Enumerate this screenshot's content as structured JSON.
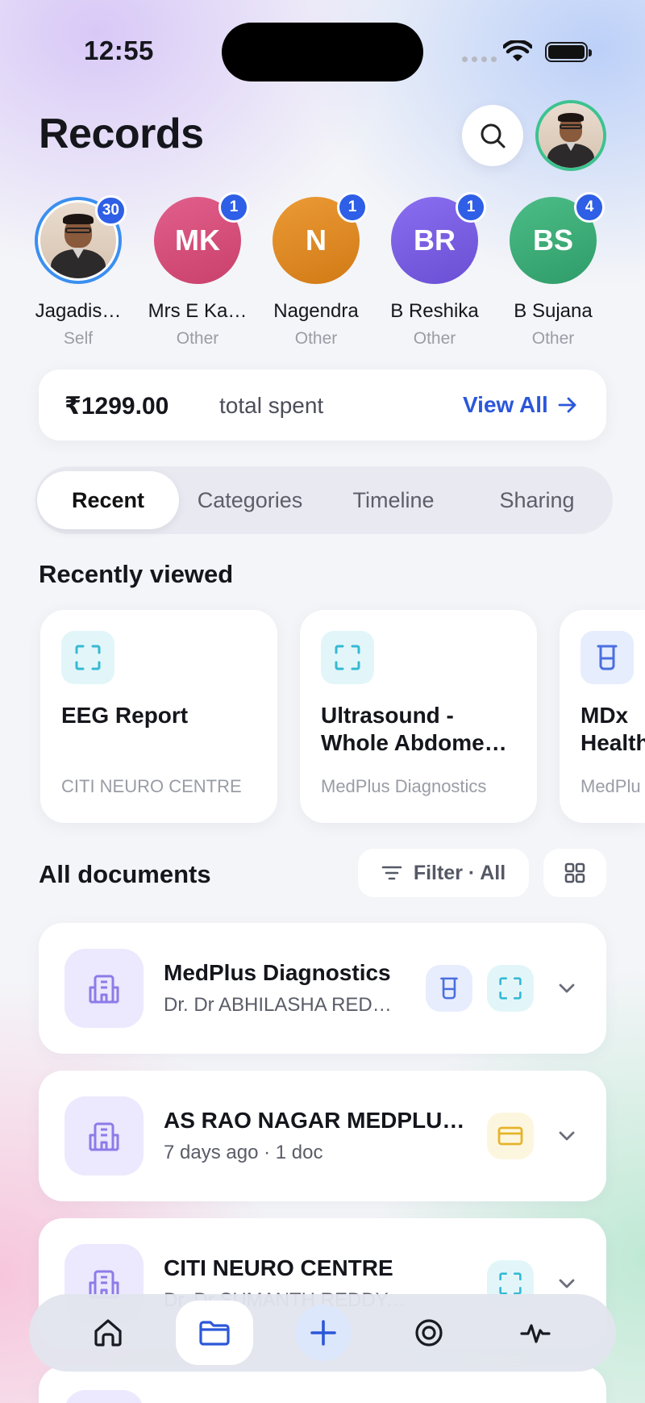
{
  "status_bar": {
    "time": "12:55"
  },
  "header": {
    "title": "Records"
  },
  "members": [
    {
      "name": "Jagadis…",
      "relation": "Self",
      "count": "30",
      "initials": "",
      "color": "#3b8ff0"
    },
    {
      "name": "Mrs E Ka…",
      "relation": "Other",
      "count": "1",
      "initials": "MK",
      "color": "#d94f7e"
    },
    {
      "name": "Nagendra",
      "relation": "Other",
      "count": "1",
      "initials": "N",
      "color": "#e08a25"
    },
    {
      "name": "B Reshika",
      "relation": "Other",
      "count": "1",
      "initials": "BR",
      "color": "#7b5ee2"
    },
    {
      "name": "B Sujana",
      "relation": "Other",
      "count": "4",
      "initials": "BS",
      "color": "#3ead77"
    }
  ],
  "spending": {
    "amount": "₹1299.00",
    "label": "total spent",
    "link": "View All"
  },
  "tabs": [
    "Recent",
    "Categories",
    "Timeline",
    "Sharing"
  ],
  "recent": {
    "title": "Recently viewed",
    "cards": [
      {
        "title": "EEG Report",
        "subtitle": "CITI NEURO CENTRE",
        "icon": "scan-icon"
      },
      {
        "title": "Ultrasound - Whole Abdome…",
        "subtitle": "MedPlus Diagnostics",
        "icon": "scan-icon"
      },
      {
        "title": "MDx Health",
        "subtitle": "MedPlu",
        "icon": "lab-test-icon"
      }
    ]
  },
  "documents": {
    "title": "All documents",
    "filter_label": "Filter · All",
    "items": [
      {
        "title": "MedPlus Diagnostics",
        "subtitle": "Dr. Dr ABHILASHA REDD…",
        "tags": [
          "lab-test-icon",
          "scan-icon"
        ]
      },
      {
        "title": "AS RAO NAGAR MEDPLU…",
        "subtitle": "7 days ago · 1 doc",
        "tags": [
          "bill-icon"
        ]
      },
      {
        "title": "CITI NEURO CENTRE",
        "subtitle": "Dr. Dr SUMANTH REDDY, ST…",
        "tags": [
          "scan-icon"
        ]
      }
    ]
  },
  "bottom_nav": [
    "home-icon",
    "folder-icon",
    "add-icon",
    "target-icon",
    "activity-icon"
  ],
  "colors": {
    "accent": "#2b57d9",
    "badge": "#2e5fe6"
  }
}
